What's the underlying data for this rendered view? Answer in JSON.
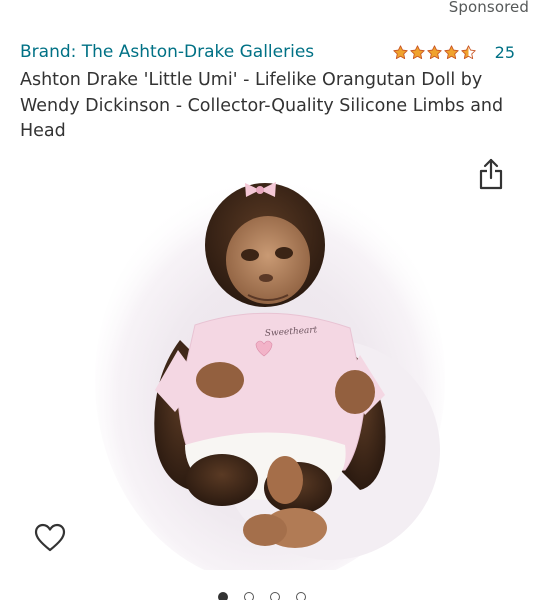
{
  "sponsored_label": "Sponsored",
  "brand": {
    "label": "Brand: The Ashton-Drake Galleries"
  },
  "rating": {
    "stars": 4.5,
    "count": "25",
    "star_color": "#f0a22e"
  },
  "product": {
    "title": "Ashton Drake 'Little Umi' - Lifelike Orangutan Doll by Wendy Dickinson - Collector-Quality Silicone Limbs and Head",
    "shirt_text": "Sweetheart"
  },
  "icons": {
    "share": "share-icon",
    "wishlist": "heart-outline-icon"
  },
  "carousel": {
    "total": 4,
    "active_index": 0
  },
  "colors": {
    "link": "#007185",
    "text": "#333333",
    "muted": "#565959"
  }
}
